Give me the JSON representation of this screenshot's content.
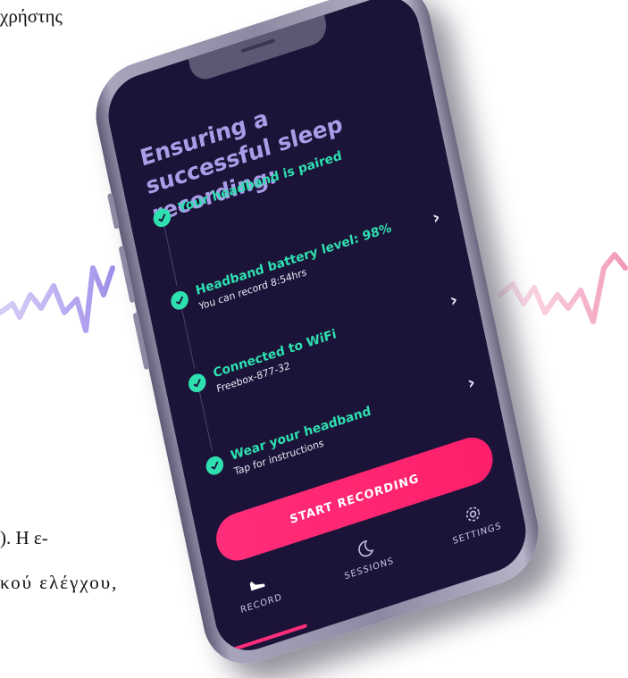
{
  "document": {
    "top_fragment": "χρήστης",
    "bottom_fragment_1": "). Η ε-",
    "bottom_fragment_2": "κού  ελέγχου,"
  },
  "app": {
    "screen_title": "Ensuring a successful sleep recording:",
    "steps": [
      {
        "title": "Your headband is paired",
        "subtitle": "",
        "has_chevron": false
      },
      {
        "title": "Headband battery level: 98%",
        "subtitle": "You can record 8:54hrs",
        "has_chevron": true
      },
      {
        "title": "Connected to WiFi",
        "subtitle": "Freebox-877-32",
        "has_chevron": true
      },
      {
        "title": "Wear your headband",
        "subtitle": "Tap for instructions",
        "has_chevron": true
      }
    ],
    "primary_button": "START RECORDING",
    "tabs": [
      {
        "label": "RECORD",
        "icon": "sleep-figure-icon",
        "active": true
      },
      {
        "label": "SESSIONS",
        "icon": "moon-icon",
        "active": false
      },
      {
        "label": "SETTINGS",
        "icon": "gear-icon",
        "active": false
      }
    ],
    "colors": {
      "background": "#1c1438",
      "title": "#a89ee8",
      "check": "#2ee0b0",
      "accent": "#ff2d7a"
    }
  }
}
